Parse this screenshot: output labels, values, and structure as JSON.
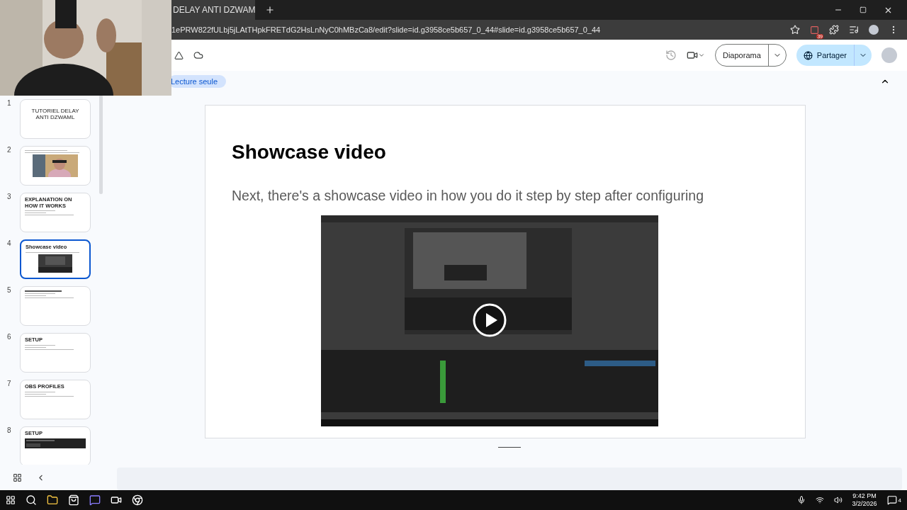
{
  "browser": {
    "tab_title": "DELAY ANTI DZWAM",
    "url": "1ePRW822fULbj5jLAtTHpkFRETdG2HsLnNyC0hMBzCa8/edit?slide=id.g3958ce5b657_0_44#slide=id.g3958ce5b657_0_44",
    "extension_badge": "39"
  },
  "toolbar": {
    "slideshow_button": "Diaporama",
    "share_button": "Partager"
  },
  "mode_chip": "Lecture seule",
  "filmstrip": [
    {
      "number": "1",
      "title": "TUTORIEL DELAY ANTI DZWAML",
      "selected": false,
      "kind": "title"
    },
    {
      "number": "2",
      "selected": false
    },
    {
      "number": "3",
      "title": "EXPLANATION ON HOW IT WORKS",
      "selected": false,
      "kind": "text"
    },
    {
      "number": "4",
      "title": "Showcase video",
      "selected": true,
      "kind": "video"
    },
    {
      "number": "5",
      "selected": false,
      "kind": "text"
    },
    {
      "number": "6",
      "title": "SETUP",
      "selected": false,
      "kind": "text"
    },
    {
      "number": "7",
      "title": "OBS PROFILES",
      "selected": false,
      "kind": "text"
    },
    {
      "number": "8",
      "title": "SETUP",
      "selected": false,
      "kind": "screen"
    }
  ],
  "slide": {
    "title": "Showcase video",
    "body": "Next, there's a showcase video in how you do it step by step after configuring"
  },
  "taskbar": {
    "time": "9:42 PM",
    "date": "3/2/2026",
    "notification_count": "4"
  }
}
